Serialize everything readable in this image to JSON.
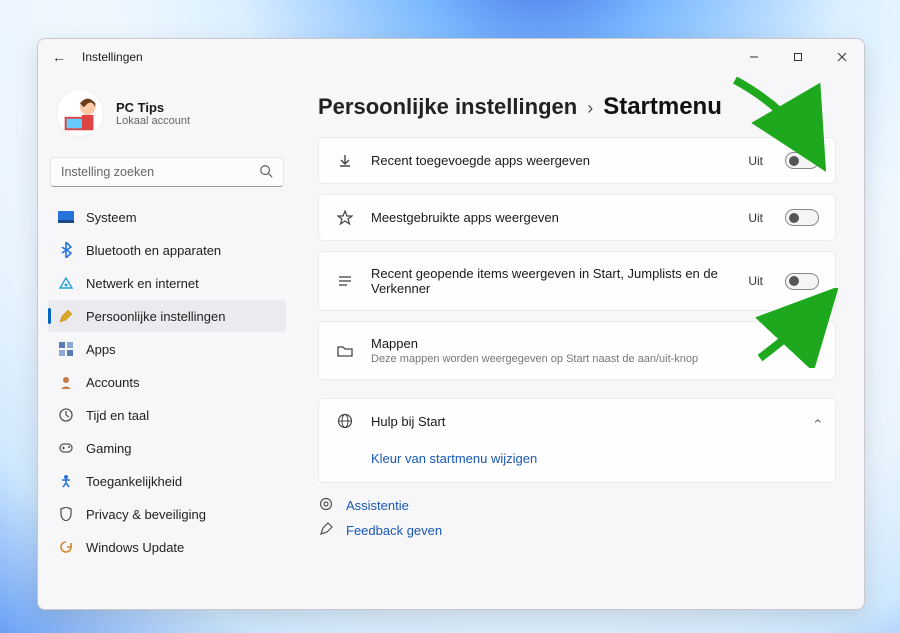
{
  "window": {
    "title": "Instellingen"
  },
  "profile": {
    "name": "PC Tips",
    "subtitle": "Lokaal account"
  },
  "search": {
    "placeholder": "Instelling zoeken"
  },
  "sidebar": {
    "items": [
      {
        "icon": "system",
        "label": "Systeem"
      },
      {
        "icon": "bluetooth",
        "label": "Bluetooth en apparaten"
      },
      {
        "icon": "network",
        "label": "Netwerk en internet"
      },
      {
        "icon": "personalization",
        "label": "Persoonlijke instellingen"
      },
      {
        "icon": "apps",
        "label": "Apps"
      },
      {
        "icon": "accounts",
        "label": "Accounts"
      },
      {
        "icon": "time",
        "label": "Tijd en taal"
      },
      {
        "icon": "gaming",
        "label": "Gaming"
      },
      {
        "icon": "accessibility",
        "label": "Toegankelijkheid"
      },
      {
        "icon": "privacy",
        "label": "Privacy & beveiliging"
      },
      {
        "icon": "update",
        "label": "Windows Update"
      }
    ]
  },
  "breadcrumb": {
    "parent": "Persoonlijke instellingen",
    "current": "Startmenu"
  },
  "settings": [
    {
      "icon": "download",
      "title": "Recent toegevoegde apps weergeven",
      "status": "Uit",
      "type": "toggle"
    },
    {
      "icon": "star",
      "title": "Meestgebruikte apps weergeven",
      "status": "Uit",
      "type": "toggle"
    },
    {
      "icon": "list",
      "title": "Recent geopende items weergeven in Start, Jumplists en de Verkenner",
      "status": "Uit",
      "type": "toggle"
    },
    {
      "icon": "folder",
      "title": "Mappen",
      "sub": "Deze mappen worden weergegeven op Start naast de aan/uit-knop",
      "type": "nav"
    }
  ],
  "help": {
    "title": "Hulp bij Start",
    "link": "Kleur van startmenu wijzigen"
  },
  "footer": {
    "assist": "Assistentie",
    "feedback": "Feedback geven"
  },
  "colors": {
    "accent": "#0067c0",
    "link": "#1858b8",
    "arrow": "#1ea81e"
  }
}
